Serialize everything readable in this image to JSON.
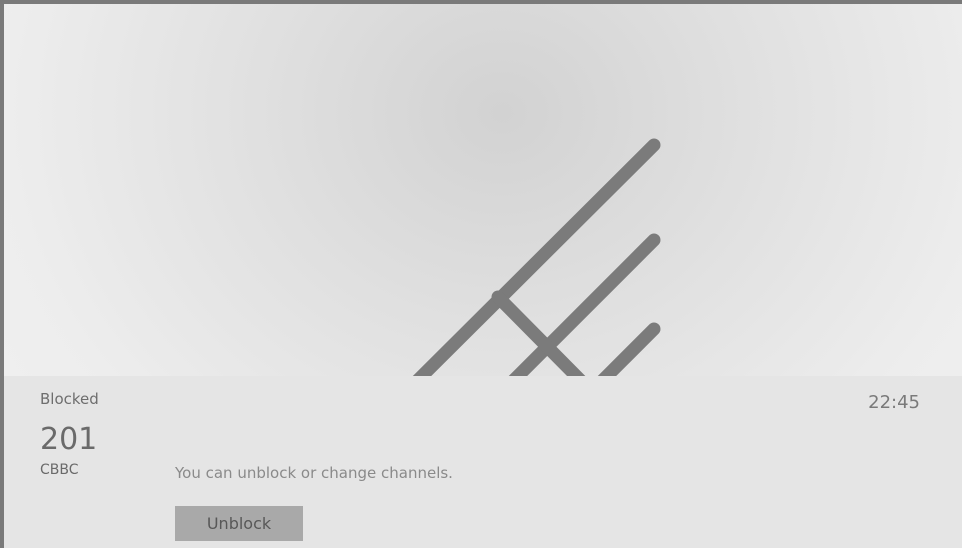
{
  "status": {
    "label": "Blocked"
  },
  "clock": {
    "time": "22:45"
  },
  "channel": {
    "number": "201",
    "name": "CBBC"
  },
  "message": {
    "text": "You can unblock or change channels."
  },
  "actions": {
    "unblock_label": "Unblock"
  },
  "icons": {
    "antenna": "antenna-icon"
  },
  "colors": {
    "icon": "#7b7b7b",
    "panel": "#e5e5e5",
    "button": "#a9a9a9"
  }
}
